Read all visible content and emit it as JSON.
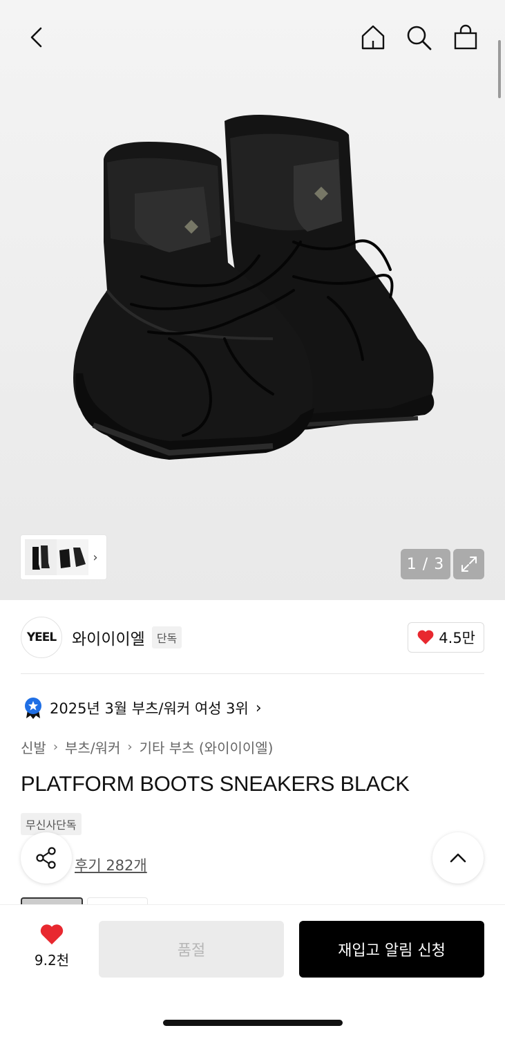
{
  "header": {
    "back_icon": "chevron-left-icon",
    "home_icon": "home-icon",
    "search_icon": "search-icon",
    "cart_icon": "shopping-bag-icon"
  },
  "gallery": {
    "page_indicator": "1 / 3",
    "thumb_chevron": "›"
  },
  "brand": {
    "logo_text": "YEEL",
    "name": "와이이이엘",
    "tag": "단독",
    "likes": "4.5만",
    "heart_color": "#e8282f"
  },
  "ranking": {
    "text": "2025년 3월 부츠/워커 여성 3위",
    "chevron": "›"
  },
  "breadcrumb": {
    "items": [
      "신발",
      "부츠/워커",
      "기타 부츠 (와이이이엘)"
    ],
    "separator": "›"
  },
  "product": {
    "title": "PLATFORM BOOTS SNEAKERS BLACK",
    "exclusive_tag": "무신사단독",
    "reviews": "후기 282개"
  },
  "bottom": {
    "like_count": "9.2천",
    "soldout_label": "품절",
    "restock_label": "재입고 알림 신청"
  }
}
